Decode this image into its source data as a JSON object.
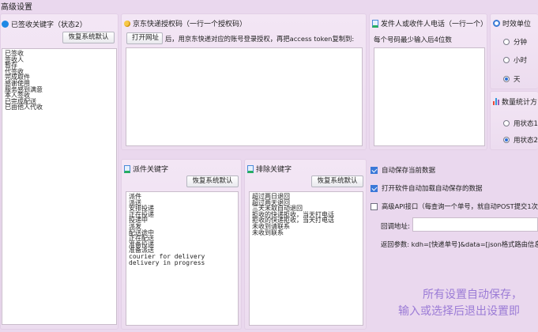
{
  "window_title": "高级设置",
  "signed_keywords": {
    "title": "已签收关键字（状态2）",
    "reset_label": "恢复系统默认",
    "items": [
      "已签收",
      "签收人",
      "暂存",
      "代签收",
      "完成取件",
      "感谢使用",
      "服务感到满意",
      "本人签收",
      "已完成配送",
      "已由他人代收"
    ]
  },
  "jd_auth": {
    "title": "京东快递授权码（一行一个授权码）",
    "open_button": "打开网址",
    "hint": "后，用京东快递对应的账号登录授权，再把access token复制到:"
  },
  "phone": {
    "title": "发件人或收件人电话（一行一个）",
    "hint": "每个号码最少输入后4位数"
  },
  "time_unit": {
    "title": "时效单位",
    "options": [
      "分钟",
      "小时",
      "天"
    ],
    "selected_index": 2
  },
  "stats": {
    "title": "数量统计方",
    "options": [
      "用状态1",
      "用状态2"
    ],
    "selected_index": 1
  },
  "dispatch_keywords": {
    "title": "派件关键字",
    "reset_label": "恢复系统默认",
    "items": [
      "派件",
      "派送",
      "安排投递",
      "正在投递",
      "投递中",
      "派发",
      "配送途中",
      "正在配送",
      "准备投递",
      "准备派送",
      "courier for delivery",
      "delivery in progress"
    ]
  },
  "exclude_keywords": {
    "title": "排除关键字",
    "reset_label": "恢复系统默认",
    "items": [
      "超过两日退回",
      "超过两天退回",
      "三天未取自动退回",
      "拒收的快递拒收，当天打电话",
      "拒收的快递拒收，当天打电话",
      "未收到请联系",
      "未收到联系"
    ]
  },
  "options": {
    "auto_save": "自动保存当前数据",
    "auto_load": "打开软件自动加载自动保存的数据",
    "api": "高级API接口（每查询一个单号，就自动POST提交1次到",
    "callback_label": "回调地址:",
    "callback_value": "",
    "return_label": "返回参数: kdh=[快递单号]&data=[json格式路由信息"
  },
  "footer": {
    "line1": "所有设置自动保存，",
    "line2": "输入或选择后退出设置即"
  },
  "colors": {
    "accent": "#3a78d8",
    "notice": "#9b7bd6",
    "panel_bg": "#f1e3f3"
  }
}
